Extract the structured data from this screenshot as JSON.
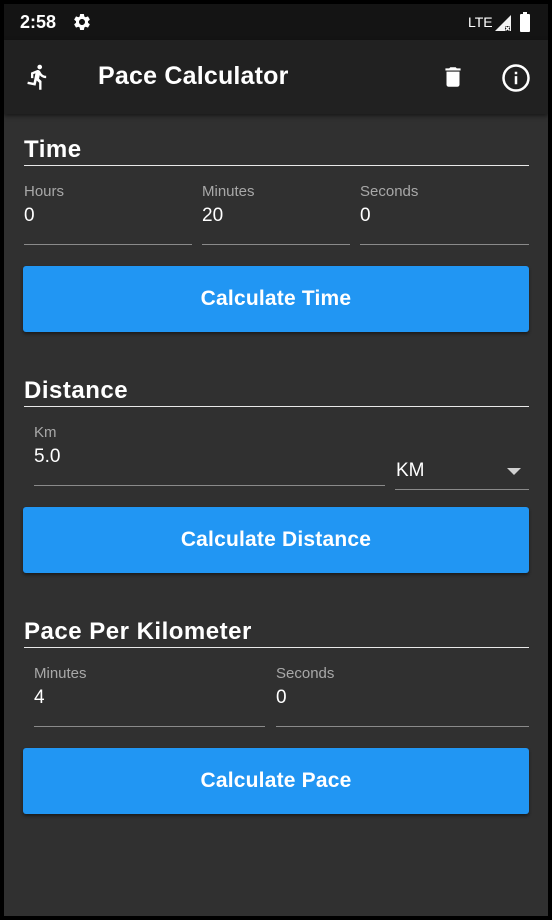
{
  "status_bar": {
    "time": "2:58",
    "network": "LTE"
  },
  "app_bar": {
    "title": "Pace Calculator"
  },
  "time_section": {
    "title": "Time",
    "fields": [
      {
        "label": "Hours",
        "value": "0"
      },
      {
        "label": "Minutes",
        "value": "20"
      },
      {
        "label": "Seconds",
        "value": "0"
      }
    ],
    "button_label": "Calculate Time"
  },
  "distance_section": {
    "title": "Distance",
    "field": {
      "label": "Km",
      "value": "5.0"
    },
    "unit_selected": "KM",
    "button_label": "Calculate Distance"
  },
  "pace_section": {
    "title": "Pace Per Kilometer",
    "fields": [
      {
        "label": "Minutes",
        "value": "4"
      },
      {
        "label": "Seconds",
        "value": "0"
      }
    ],
    "button_label": "Calculate Pace"
  },
  "colors": {
    "accent": "#2196f3",
    "background": "#303030",
    "app_bar": "#212121",
    "status_bar": "#141414"
  }
}
